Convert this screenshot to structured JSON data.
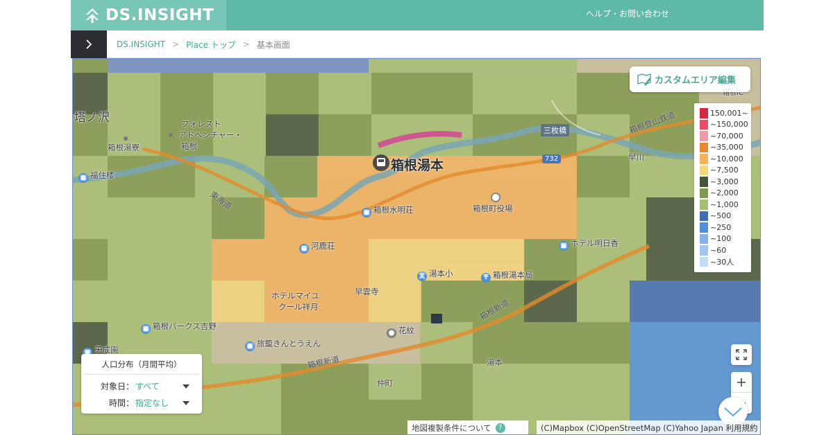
{
  "header": {
    "logo_text": "DS.INSIGHT",
    "help_link": "ヘルプ・お問い合わせ"
  },
  "breadcrumb": {
    "items": [
      "DS.INSIGHT",
      "Place トップ",
      "基本画面"
    ]
  },
  "map": {
    "places": {
      "tounosawa": "塔ノ沢",
      "forest_1": "フォレスト",
      "forest_2": "アドベンチャー・",
      "forest_3": "箱根",
      "hakone_yuryo": "箱根湯寮",
      "fukuzumiro": "福住楼",
      "hakone_yumoto": "箱根湯本",
      "suimeiso": "箱根水明荘",
      "town_office": "箱根町役場",
      "kajikaso": "河鹿荘",
      "hotel_asuka": "ホテル明日香",
      "yumoto_elem": "湯本小",
      "yumoto_post": "箱根湯本局",
      "soun_ji": "早雲寺",
      "hotel_maiyu_1": "ホテルマイユ",
      "hotel_maiyu_2": "クール祥月",
      "park_yoshino": "箱根パークス吉野",
      "hanaougi": "花紋",
      "kinsuien": "旅籠きんとうえん",
      "tenseien": "天成園",
      "yumoto_area": "湯本",
      "nakamachi": "仲町",
      "sanmaibashi": "三枚橋",
      "hayakawa": "早川",
      "yumoto_ic": "箱根IC"
    },
    "roads": {
      "tokaido": "東海道",
      "hakone_shindo_1": "箱根新道",
      "hakone_shindo_2": "箱根新道",
      "tozan_railway": "箱根登山鉄道",
      "route_number": "732"
    },
    "edit_button": "カスタムエリア編集",
    "legend": [
      {
        "label": "150,001~",
        "color": "#d7263d"
      },
      {
        "label": "~150,000",
        "color": "#ec4a65"
      },
      {
        "label": "~70,000",
        "color": "#f29aa5"
      },
      {
        "label": "~35,000",
        "color": "#e9872b"
      },
      {
        "label": "~10,000",
        "color": "#f6b25b"
      },
      {
        "label": "~7,500",
        "color": "#f8d77a"
      },
      {
        "label": "~3,000",
        "color": "#44553a"
      },
      {
        "label": "~2,000",
        "color": "#7f9a4e"
      },
      {
        "label": "~1,000",
        "color": "#a7bf72"
      },
      {
        "label": "~500",
        "color": "#3d6db5"
      },
      {
        "label": "~250",
        "color": "#4d90dd"
      },
      {
        "label": "~100",
        "color": "#86b2ea"
      },
      {
        "label": "~60",
        "color": "#a3c6f0"
      },
      {
        "label": "~30人",
        "color": "#c4dcf6"
      }
    ],
    "filter": {
      "title": "人口分布（月間平均）",
      "date_label": "対象日：",
      "date_value": "すべて",
      "time_label": "時間：",
      "time_value": "指定なし"
    },
    "attribution_left": "地図複製条件について",
    "attribution_right": "(C)Mapbox (C)OpenStreetMap (C)Yahoo Japan 利用規約"
  }
}
